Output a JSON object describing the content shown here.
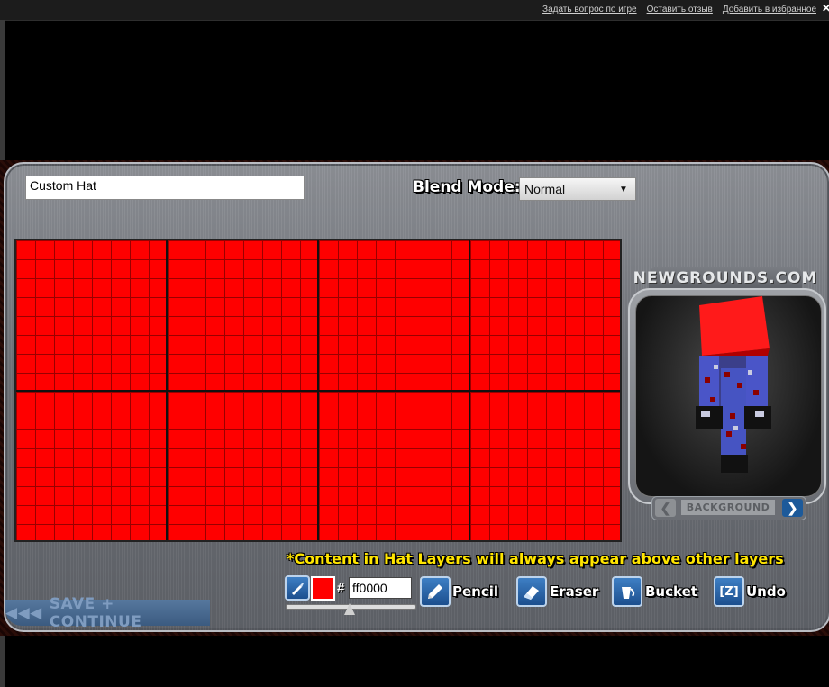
{
  "top_links": [
    "Задать вопрос по игре",
    "Оставить отзыв",
    "Добавить в избранное"
  ],
  "top_close": "✕",
  "hat_name": "Custom Hat",
  "blend": {
    "label": "Blend Mode:",
    "value": "Normal"
  },
  "preview": {
    "logo": "NEWGROUNDS.COM",
    "bg_label": "BACKGROUND"
  },
  "notice": "*Content in Hat Layers will always appear above other layers",
  "color": {
    "hash": "#",
    "hex": "ff0000",
    "swatch": "#ff0000"
  },
  "tools": {
    "pencil": "Pencil",
    "eraser": "Eraser",
    "bucket": "Bucket",
    "undo": "Undo",
    "undo_key": "[Z]"
  },
  "save_button": "SAVE + CONTINUE",
  "canvas_fill": "#ff0000",
  "accent": "#1c4f8e"
}
